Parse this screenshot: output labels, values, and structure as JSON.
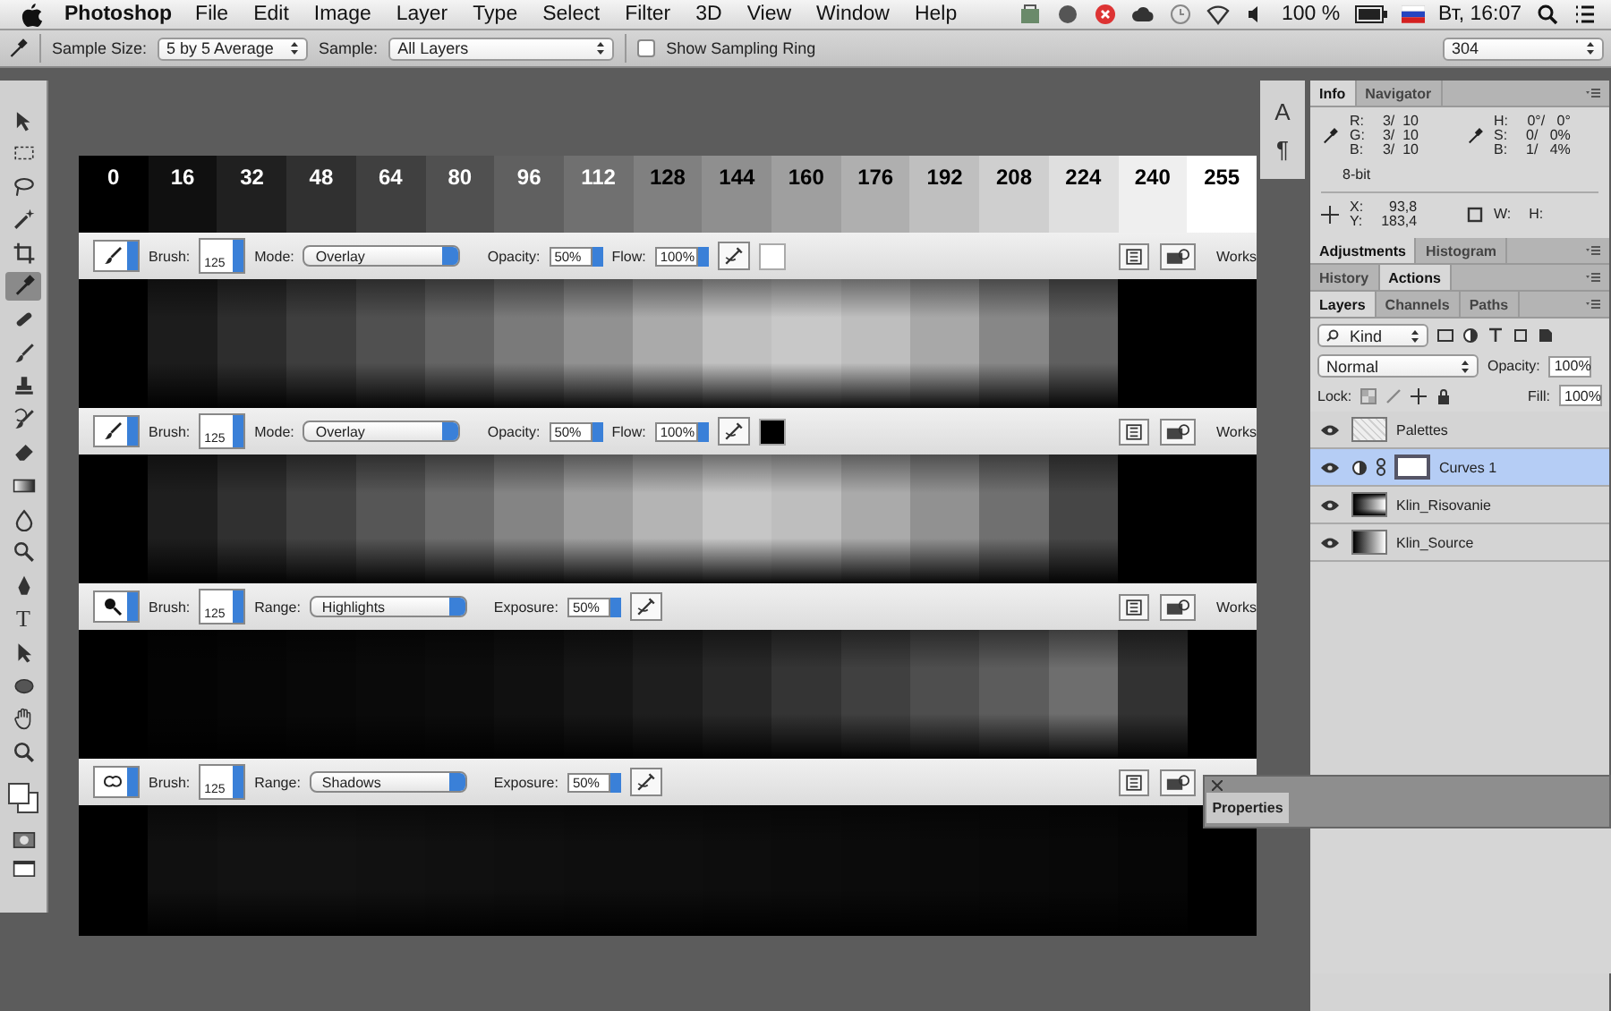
{
  "menu_bar": {
    "app_name": "Photoshop",
    "items": [
      "File",
      "Edit",
      "Image",
      "Layer",
      "Type",
      "Select",
      "Filter",
      "3D",
      "View",
      "Window",
      "Help"
    ],
    "battery": "100 %",
    "clock": "Вт, 16:07"
  },
  "options_bar": {
    "sample_size_label": "Sample Size:",
    "sample_size": "5 by 5 Average",
    "sample_label": "Sample:",
    "sample": "All Layers",
    "sampling_ring": {
      "label": "Show Sampling Ring",
      "checked": false
    },
    "preset": "304"
  },
  "tools": [
    {
      "kind": "move",
      "selected": false
    },
    {
      "kind": "marquee",
      "selected": false
    },
    {
      "kind": "lasso",
      "selected": false
    },
    {
      "kind": "wand",
      "selected": false
    },
    {
      "kind": "crop",
      "selected": false
    },
    {
      "kind": "eyedropper",
      "selected": true
    },
    {
      "kind": "healing",
      "selected": false
    },
    {
      "kind": "brush",
      "selected": false
    },
    {
      "kind": "stamp",
      "selected": false
    },
    {
      "kind": "history",
      "selected": false
    },
    {
      "kind": "eraser",
      "selected": false
    },
    {
      "kind": "gradient",
      "selected": false
    },
    {
      "kind": "blur",
      "selected": false
    },
    {
      "kind": "dodge",
      "selected": false
    },
    {
      "kind": "pen",
      "selected": false
    },
    {
      "kind": "type",
      "glyph": "T",
      "selected": false
    },
    {
      "kind": "path",
      "selected": false
    },
    {
      "kind": "ellipse",
      "selected": false
    },
    {
      "kind": "hand",
      "selected": false
    },
    {
      "kind": "zoom",
      "selected": false
    }
  ],
  "side_dock": [
    "A",
    "¶"
  ],
  "canvas": {
    "values": [
      "0",
      "16",
      "32",
      "48",
      "64",
      "80",
      "96",
      "112",
      "128",
      "144",
      "160",
      "176",
      "192",
      "208",
      "224",
      "240",
      "255"
    ],
    "strips": [
      {
        "kind": "brush",
        "brush_label": "Brush:",
        "brush_size": "125",
        "mode_label": "Mode:",
        "mode": "Overlay",
        "amount_label": "Opacity:",
        "amount": "50%",
        "flow_label": "Flow:",
        "flow": "100%",
        "color": "#ffffff",
        "workspace": "Works"
      },
      {
        "kind": "brush",
        "brush_label": "Brush:",
        "brush_size": "125",
        "mode_label": "Mode:",
        "mode": "Overlay",
        "amount_label": "Opacity:",
        "amount": "50%",
        "flow_label": "Flow:",
        "flow": "100%",
        "color": "#000000",
        "workspace": "Works"
      },
      {
        "kind": "dodge",
        "brush_label": "Brush:",
        "brush_size": "125",
        "mode_label": "Range:",
        "mode": "Highlights",
        "amount_label": "Exposure:",
        "amount": "50%",
        "workspace": "Works"
      },
      {
        "kind": "burn",
        "brush_label": "Brush:",
        "brush_size": "125",
        "mode_label": "Range:",
        "mode": "Shadows",
        "amount_label": "Exposure:",
        "amount": "50%"
      }
    ]
  },
  "info_panel": {
    "tabs": [
      {
        "label": "Info",
        "selected": true
      },
      {
        "label": "Navigator",
        "selected": false
      }
    ],
    "rgb": [
      {
        "label": "R:",
        "value": "3/  10"
      },
      {
        "label": "G:",
        "value": "3/  10"
      },
      {
        "label": "B:",
        "value": "3/  10"
      }
    ],
    "hsb": [
      {
        "label": "H:",
        "value": "0°/   0°"
      },
      {
        "label": "S:",
        "value": "0/   0%"
      },
      {
        "label": "B:",
        "value": "1/   4%"
      }
    ],
    "depth": "8-bit",
    "xy": [
      {
        "label": "X:",
        "value": "93,8"
      },
      {
        "label": "Y:",
        "value": "183,4"
      }
    ],
    "wh": [
      {
        "label": "W:"
      },
      {
        "label": "H:"
      }
    ]
  },
  "panel_groups": [
    {
      "tabs": [
        {
          "label": "Adjustments",
          "selected": true
        },
        {
          "label": "Histogram",
          "selected": false
        }
      ]
    },
    {
      "tabs": [
        {
          "label": "History",
          "selected": false
        },
        {
          "label": "Actions",
          "selected": true
        }
      ]
    }
  ],
  "layers_panel": {
    "tabs": [
      {
        "label": "Layers",
        "selected": true
      },
      {
        "label": "Channels",
        "selected": false
      },
      {
        "label": "Paths",
        "selected": false
      }
    ],
    "filter": "Kind",
    "blend_mode": "Normal",
    "opacity_label": "Opacity:",
    "opacity": "100%",
    "lock_label": "Lock:",
    "fill_label": "Fill:",
    "fill": "100%",
    "layers": [
      {
        "name": "Palettes",
        "kind": "pattern",
        "visible": true,
        "selected": false
      },
      {
        "name": "Curves 1",
        "kind": "adjustment",
        "visible": true,
        "selected": true
      },
      {
        "name": "Klin_Risovanie",
        "kind": "steps",
        "visible": true,
        "selected": false
      },
      {
        "name": "Klin_Source",
        "kind": "gradient",
        "visible": true,
        "selected": false
      }
    ]
  },
  "properties_panel": {
    "title": "Properties"
  }
}
